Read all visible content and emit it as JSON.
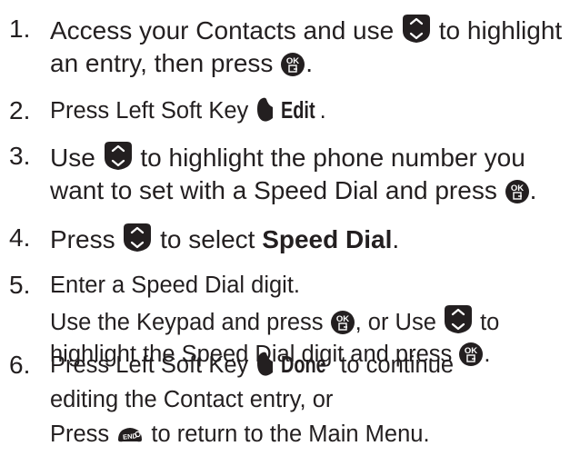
{
  "steps": [
    {
      "number": "1.",
      "lines": [
        {
          "a": "Access your Contacts and use",
          "b": "to highlight"
        },
        {
          "a": "an entry, then press",
          "b": "."
        }
      ]
    },
    {
      "number": "2.",
      "lines": [
        {
          "a": "Press Left Soft Key",
          "b": "Edit",
          "c": "."
        }
      ]
    },
    {
      "number": "3.",
      "lines": [
        {
          "a": "Use",
          "b": "to highlight the phone number you"
        },
        {
          "a": "want to set with a Speed Dial and press",
          "b": "."
        }
      ]
    },
    {
      "number": "4.",
      "lines": [
        {
          "a": "Press",
          "b": "to select",
          "c": "Speed Dial",
          "d": "."
        }
      ]
    },
    {
      "number": "5.",
      "lines": [
        {
          "a": "Enter a Speed Dial digit."
        },
        {
          "a": "Use the Keypad and press",
          "b": ", or Use",
          "c": "to"
        },
        {
          "a": "highlight the Speed Dial digit and press",
          "b": "."
        }
      ]
    },
    {
      "number": "6.",
      "lines": [
        {
          "a": "Press Left Soft Key",
          "b": "Done",
          "c": "to continue"
        },
        {
          "a": "editing the Contact entry, or"
        },
        {
          "a": "Press",
          "b": "to return to the Main Menu."
        }
      ]
    }
  ],
  "icons": {
    "nav_key": "nav-key-icon",
    "ok_key": "ok-key-icon",
    "left_soft_key": "left-soft-key-icon",
    "end_key": "end-key-icon",
    "ok_label": "OK",
    "end_label": "END"
  },
  "colors": {
    "text": "#231f20",
    "icon_fill": "#231f20",
    "icon_text": "#ffffff"
  }
}
